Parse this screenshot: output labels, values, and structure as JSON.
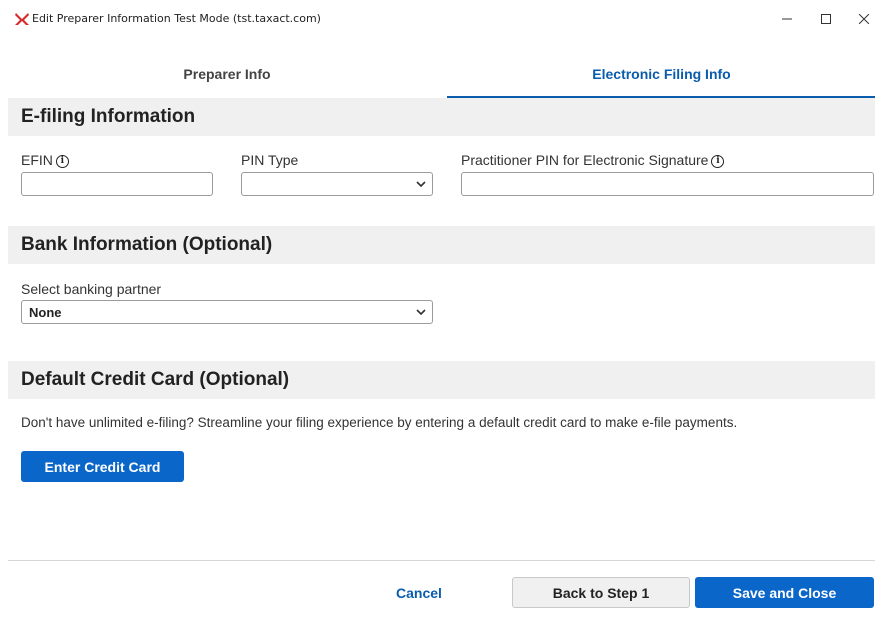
{
  "window": {
    "title": "Edit Preparer Information Test Mode (tst.taxact.com)",
    "minimize_glyph": "–",
    "maximize_glyph": "☐",
    "close_glyph": "✕",
    "brand_color": "#d72a2a"
  },
  "tabs": [
    {
      "label": "Preparer Info",
      "active": false
    },
    {
      "label": "Electronic Filing Info",
      "active": true
    }
  ],
  "efiling": {
    "heading": "E-filing Information",
    "efin_label": "EFIN",
    "efin_value": "",
    "pin_type_label": "PIN Type",
    "pin_type_value": "",
    "practitioner_pin_label": "Practitioner PIN for Electronic Signature",
    "practitioner_pin_value": "",
    "info_glyph": "i"
  },
  "bank": {
    "heading": "Bank Information (Optional)",
    "partner_label": "Select banking partner",
    "partner_value": "None"
  },
  "credit_card": {
    "heading": "Default Credit Card (Optional)",
    "message": "Don't have unlimited e-filing? Streamline your filing experience by entering a default credit card to make e-file payments.",
    "enter_button": "Enter Credit Card"
  },
  "footer": {
    "cancel": "Cancel",
    "back": "Back to Step 1",
    "save": "Save and Close"
  },
  "colors": {
    "accent": "#0b66c9",
    "tab_active": "#0b5cad",
    "section_bg": "#f0f0f0"
  }
}
